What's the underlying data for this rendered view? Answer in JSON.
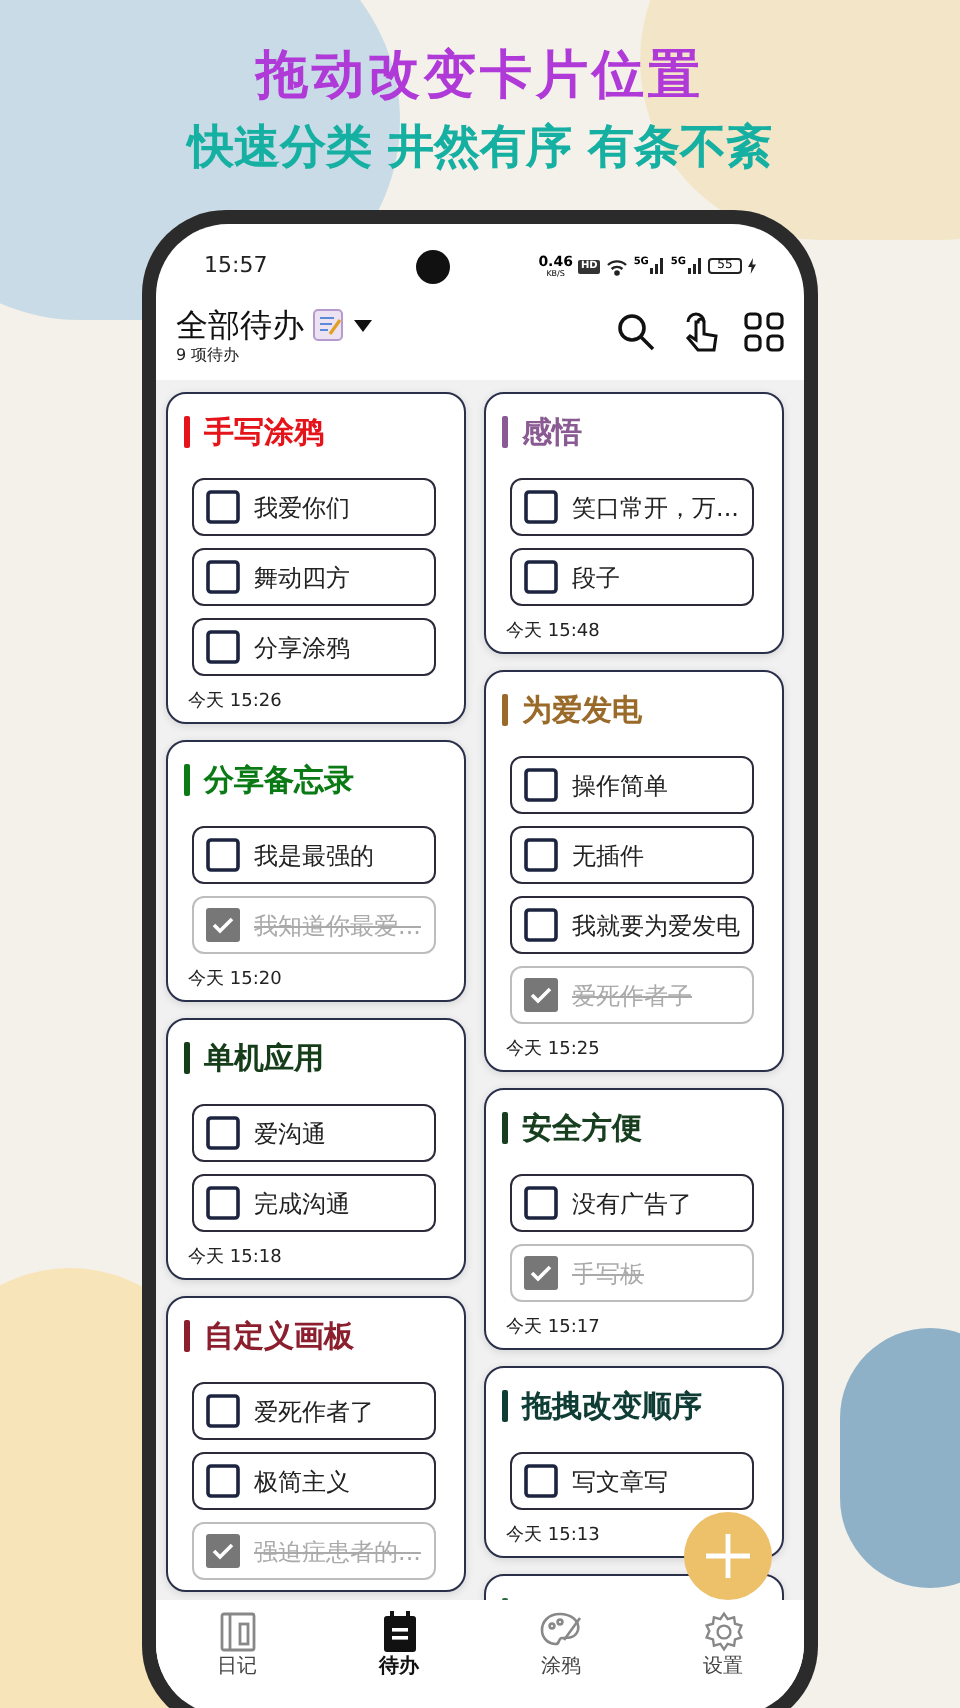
{
  "headline": {
    "title": "拖动改变卡片位置",
    "subtitle": "快速分类 井然有序 有条不紊"
  },
  "status_bar": {
    "time": "15:57",
    "net_speed": "0.46",
    "net_unit": "KB/S",
    "hd": "HD",
    "signal_labels": [
      "5G",
      "5G"
    ],
    "battery": "55"
  },
  "header": {
    "title": "全部待办",
    "count": "9 项待办"
  },
  "columns": [
    {
      "cards": [
        {
          "title": "手写涂鸦",
          "color": "#e5141b",
          "time": "今天 15:26",
          "items": [
            {
              "text": "我爱你们",
              "checked": false
            },
            {
              "text": "舞动四方",
              "checked": false
            },
            {
              "text": "分享涂鸦",
              "checked": false
            }
          ]
        },
        {
          "title": "分享备忘录",
          "color": "#0a7a14",
          "time": "今天 15:20",
          "items": [
            {
              "text": "我是最强的",
              "checked": false
            },
            {
              "text": "我知道你最爱...",
              "checked": true
            }
          ]
        },
        {
          "title": "单机应用",
          "color": "#163d1a",
          "time": "今天 15:18",
          "items": [
            {
              "text": "爱沟通",
              "checked": false
            },
            {
              "text": "完成沟通",
              "checked": false
            }
          ]
        },
        {
          "title": "自定义画板",
          "color": "#8b1f2e",
          "items": [
            {
              "text": "爱死作者了",
              "checked": false
            },
            {
              "text": "极简主义",
              "checked": false
            },
            {
              "text": "强迫症患者的...",
              "checked": true
            }
          ]
        }
      ]
    },
    {
      "cards": [
        {
          "title": "感悟",
          "color": "#8a5a92",
          "time": "今天 15:48",
          "items": [
            {
              "text": "笑口常开，万...",
              "checked": false
            },
            {
              "text": "段子",
              "checked": false
            }
          ]
        },
        {
          "title": "为爱发电",
          "color": "#9a6a2a",
          "time": "今天 15:25",
          "items": [
            {
              "text": "操作简单",
              "checked": false
            },
            {
              "text": "无插件",
              "checked": false
            },
            {
              "text": "我就要为爱发电",
              "checked": false
            },
            {
              "text": "爱死作者子",
              "checked": true
            }
          ]
        },
        {
          "title": "安全方便",
          "color": "#173f1f",
          "time": "今天 15:17",
          "items": [
            {
              "text": "没有广告了",
              "checked": false
            },
            {
              "text": "手写板",
              "checked": true
            }
          ]
        },
        {
          "title": "拖拽改变顺序",
          "color": "#0f3d35",
          "time": "今天 15:13",
          "items": [
            {
              "text": "写文章写",
              "checked": false
            }
          ]
        },
        {
          "color": "#2d6a3a"
        }
      ]
    }
  ],
  "nav": [
    {
      "label": "日记",
      "kind": "diary",
      "selected": false
    },
    {
      "label": "待办",
      "kind": "todo",
      "selected": true
    },
    {
      "label": "涂鸦",
      "kind": "palette",
      "selected": false
    },
    {
      "label": "设置",
      "kind": "settings",
      "selected": false
    }
  ]
}
